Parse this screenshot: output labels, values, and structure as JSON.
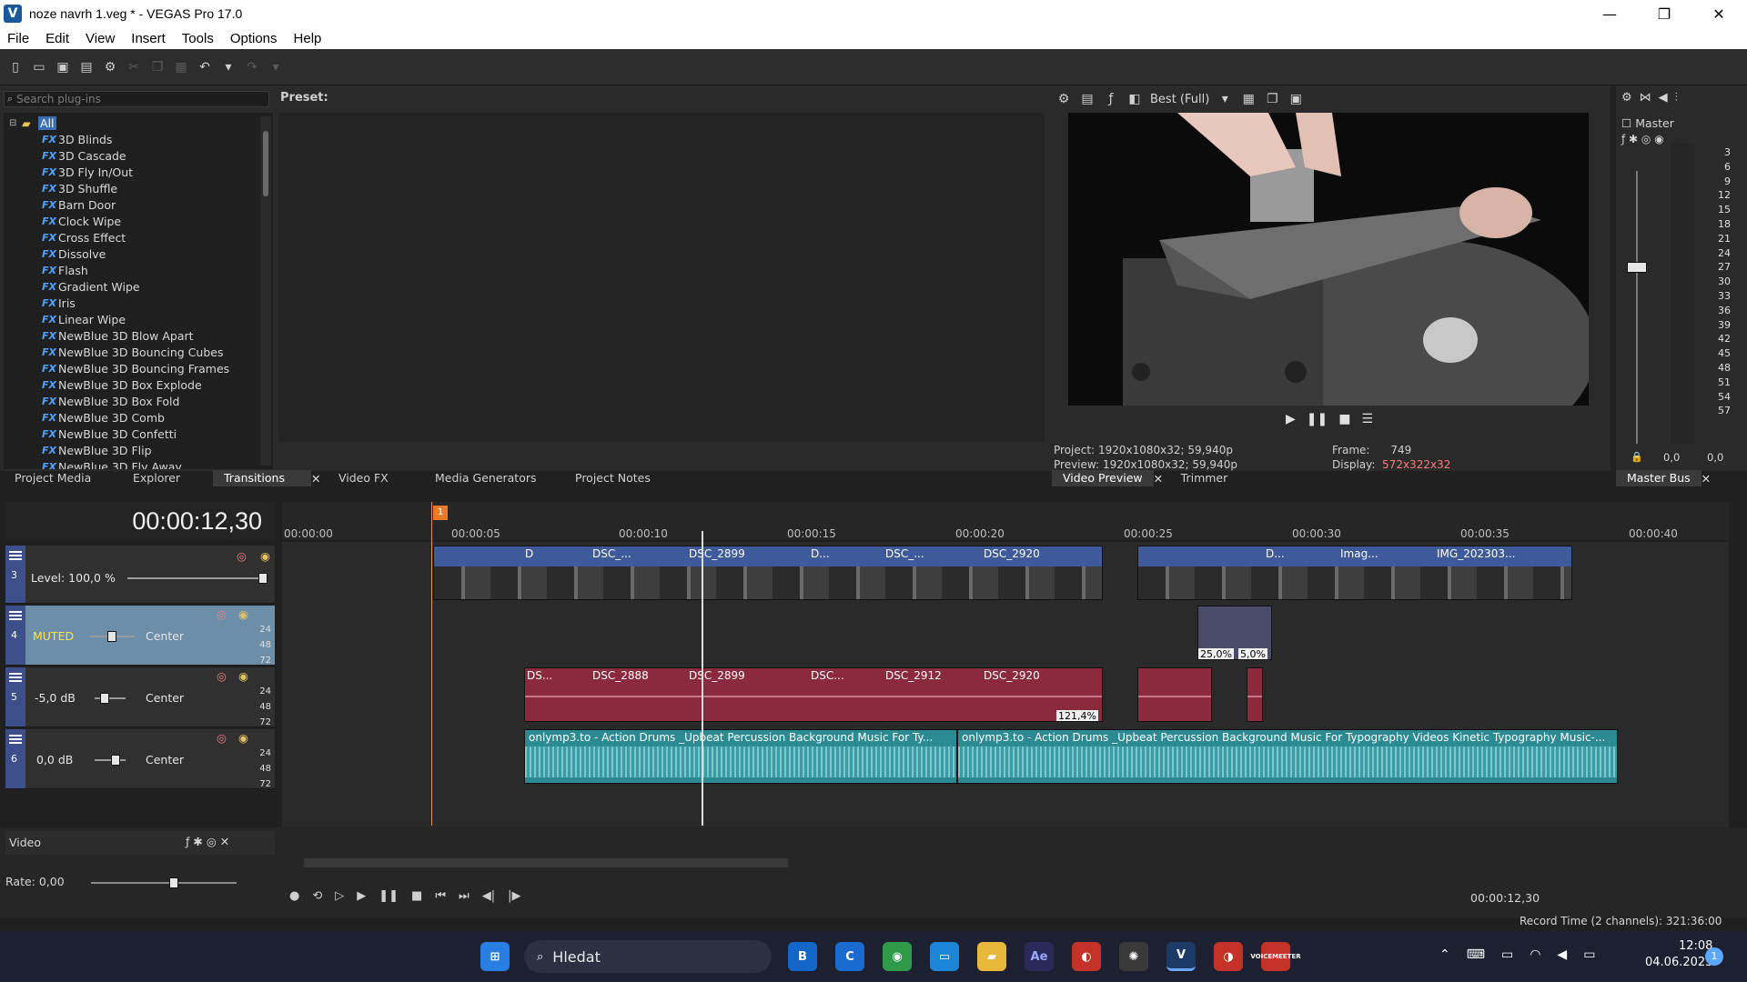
{
  "window": {
    "title": "noze navrh 1.veg * - VEGAS Pro 17.0",
    "app_icon": "V",
    "minimize": "—",
    "maximize": "❐",
    "close": "✕"
  },
  "menu": [
    "File",
    "Edit",
    "View",
    "Insert",
    "Tools",
    "Options",
    "Help"
  ],
  "plugins": {
    "search_placeholder": "Search plug-ins",
    "root": "All",
    "badge": "FX",
    "preset_label": "Preset:",
    "items": [
      "3D Blinds",
      "3D Cascade",
      "3D Fly In/Out",
      "3D Shuffle",
      "Barn Door",
      "Clock Wipe",
      "Cross Effect",
      "Dissolve",
      "Flash",
      "Gradient Wipe",
      "Iris",
      "Linear Wipe",
      "NewBlue 3D Blow Apart",
      "NewBlue 3D Bouncing Cubes",
      "NewBlue 3D Bouncing Frames",
      "NewBlue 3D Box Explode",
      "NewBlue 3D Box Fold",
      "NewBlue 3D Comb",
      "NewBlue 3D Confetti",
      "NewBlue 3D Flip",
      "NewBlue 3D Fly Away"
    ]
  },
  "left_tabs": [
    "Project Media",
    "Explorer",
    "Transitions",
    "Video FX",
    "Media Generators",
    "Project Notes"
  ],
  "preview": {
    "quality": "Best (Full)",
    "project_label": "Project:",
    "project_value": "1920x1080x32; 59,940p",
    "preview_label": "Preview:",
    "preview_value": "1920x1080x32; 59,940p",
    "frame_label": "Frame:",
    "frame_value": "749",
    "display_label": "Display:",
    "display_value": "572x322x32",
    "tabs": [
      "Video Preview",
      "Trimmer"
    ]
  },
  "master": {
    "title": "Master",
    "scale": [
      "3",
      "6",
      "9",
      "12",
      "15",
      "18",
      "21",
      "24",
      "27",
      "30",
      "33",
      "36",
      "39",
      "42",
      "45",
      "48",
      "51",
      "54",
      "57"
    ],
    "left_val": "0,0",
    "right_val": "0,0",
    "tab": "Master Bus"
  },
  "timeline": {
    "time": "00:00:12,30",
    "marker": "1",
    "ticks": [
      "00:00:00",
      "00:00:05",
      "00:00:10",
      "00:00:15",
      "00:00:20",
      "00:00:25",
      "00:00:30",
      "00:00:35",
      "00:00:40"
    ],
    "tracks": [
      {
        "num": "3",
        "label": "Level: 100,0 %"
      },
      {
        "num": "4",
        "label": "MUTED",
        "pan": "Center"
      },
      {
        "num": "5",
        "label": "-5,0 dB",
        "pan": "Center"
      },
      {
        "num": "6",
        "label": "0,0 dB",
        "pan": "Center"
      }
    ],
    "meter_scale": [
      "24",
      "48",
      "72"
    ],
    "video_clips": [
      "D",
      "DSC_...",
      "DSC_2899",
      "D...",
      "DSC_...",
      "DSC_2920",
      "D...",
      "Imag...",
      "IMG_202303..."
    ],
    "audio_clips": [
      "DS...",
      "DSC_2888",
      "DSC_2899",
      "DSC...",
      "DSC_2912",
      "DSC_2920"
    ],
    "music_clips": [
      "onlymp3.to - Action Drums _Upbeat  Percussion Background Music For Ty...",
      "onlymp3.to - Action Drums _Upbeat  Percussion Background Music For Typography Videos Kinetic  Typography Music-..."
    ],
    "percent_labels": [
      "25,0%",
      "5,0%",
      "121,4%"
    ],
    "bus_label": "Video",
    "rate_label": "Rate: 0,00",
    "cursor_time": "00:00:12,30",
    "record_time": "Record Time (2 channels): 321:36:00"
  },
  "taskbar": {
    "search": "Hledat",
    "time": "12:08",
    "date": "04.06.2023",
    "notif": "1",
    "apps": [
      "B",
      "C",
      "Chrome",
      "Desktop",
      "Files",
      "Ae",
      "App",
      "Film",
      "V",
      "App2",
      "VOICEMEETER"
    ]
  }
}
